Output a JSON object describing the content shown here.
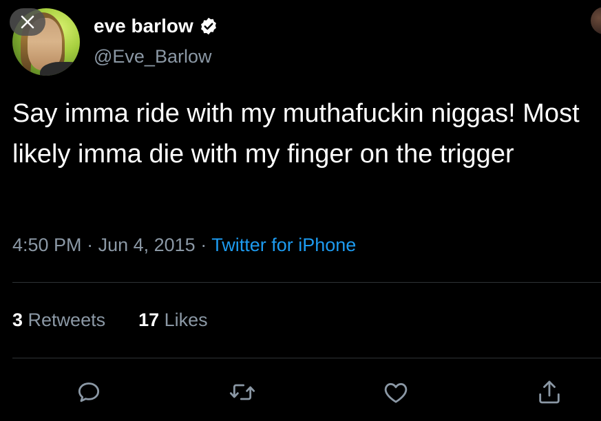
{
  "header": {
    "display_name": "eve barlow",
    "username": "@Eve_Barlow",
    "verified_icon": "verified-badge-icon",
    "close_icon": "close-icon"
  },
  "tweet": {
    "text": "Say imma ride with my muthafuckin niggas! Most likely imma die with my finger on the trigger",
    "time": "4:50 PM",
    "separator": " · ",
    "date": "Jun 4, 2015",
    "source": "Twitter for iPhone"
  },
  "stats": {
    "retweets_count": "3",
    "retweets_label": " Retweets",
    "likes_count": "17",
    "likes_label": " Likes"
  },
  "actions": {
    "reply_icon": "reply-icon",
    "retweet_icon": "retweet-icon",
    "like_icon": "heart-icon",
    "share_icon": "share-icon"
  },
  "colors": {
    "background": "#000000",
    "primary_text": "#ffffff",
    "secondary_text": "#8b98a5",
    "link": "#1d9bf0",
    "divider": "#2f3336"
  }
}
